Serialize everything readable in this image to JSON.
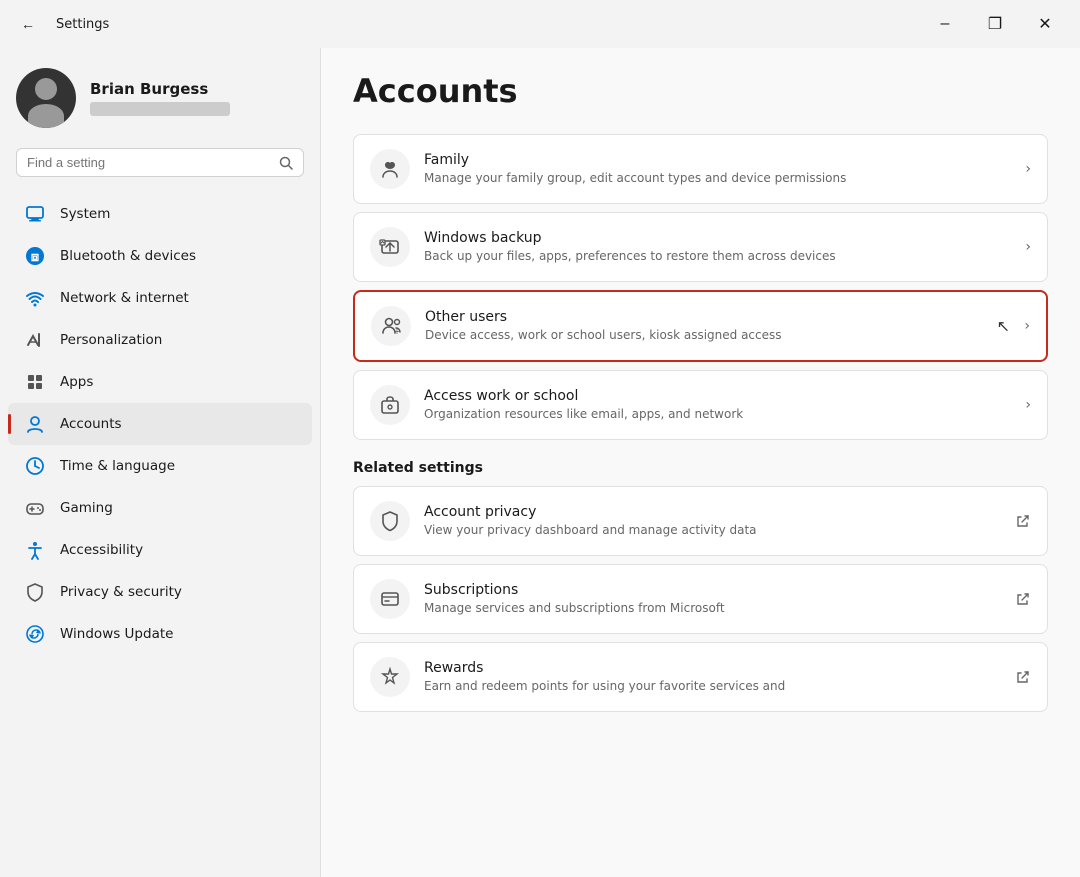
{
  "window": {
    "title": "Settings",
    "min_label": "–",
    "max_label": "❐",
    "close_label": "✕"
  },
  "profile": {
    "name": "Brian Burgess",
    "email_placeholder": "email hidden"
  },
  "search": {
    "placeholder": "Find a setting"
  },
  "nav": {
    "items": [
      {
        "id": "system",
        "label": "System",
        "active": false
      },
      {
        "id": "bluetooth",
        "label": "Bluetooth & devices",
        "active": false
      },
      {
        "id": "network",
        "label": "Network & internet",
        "active": false
      },
      {
        "id": "personalization",
        "label": "Personalization",
        "active": false
      },
      {
        "id": "apps",
        "label": "Apps",
        "active": false
      },
      {
        "id": "accounts",
        "label": "Accounts",
        "active": true
      },
      {
        "id": "time",
        "label": "Time & language",
        "active": false
      },
      {
        "id": "gaming",
        "label": "Gaming",
        "active": false
      },
      {
        "id": "accessibility",
        "label": "Accessibility",
        "active": false
      },
      {
        "id": "privacy",
        "label": "Privacy & security",
        "active": false
      },
      {
        "id": "update",
        "label": "Windows Update",
        "active": false
      }
    ]
  },
  "content": {
    "page_title": "Accounts",
    "items": [
      {
        "id": "family",
        "title": "Family",
        "subtitle": "Manage your family group, edit account types and device permissions",
        "chevron": "›",
        "highlighted": false,
        "external": false
      },
      {
        "id": "backup",
        "title": "Windows backup",
        "subtitle": "Back up your files, apps, preferences to restore them across devices",
        "chevron": "›",
        "highlighted": false,
        "external": false
      },
      {
        "id": "other-users",
        "title": "Other users",
        "subtitle": "Device access, work or school users, kiosk assigned access",
        "chevron": "›",
        "highlighted": true,
        "external": false
      },
      {
        "id": "work-school",
        "title": "Access work or school",
        "subtitle": "Organization resources like email, apps, and network",
        "chevron": "›",
        "highlighted": false,
        "external": false
      }
    ],
    "related_settings_title": "Related settings",
    "related": [
      {
        "id": "account-privacy",
        "title": "Account privacy",
        "subtitle": "View your privacy dashboard and manage activity data",
        "external": true
      },
      {
        "id": "subscriptions",
        "title": "Subscriptions",
        "subtitle": "Manage services and subscriptions from Microsoft",
        "external": true
      },
      {
        "id": "rewards",
        "title": "Rewards",
        "subtitle": "Earn and redeem points for using your favorite services and",
        "external": true
      }
    ]
  }
}
